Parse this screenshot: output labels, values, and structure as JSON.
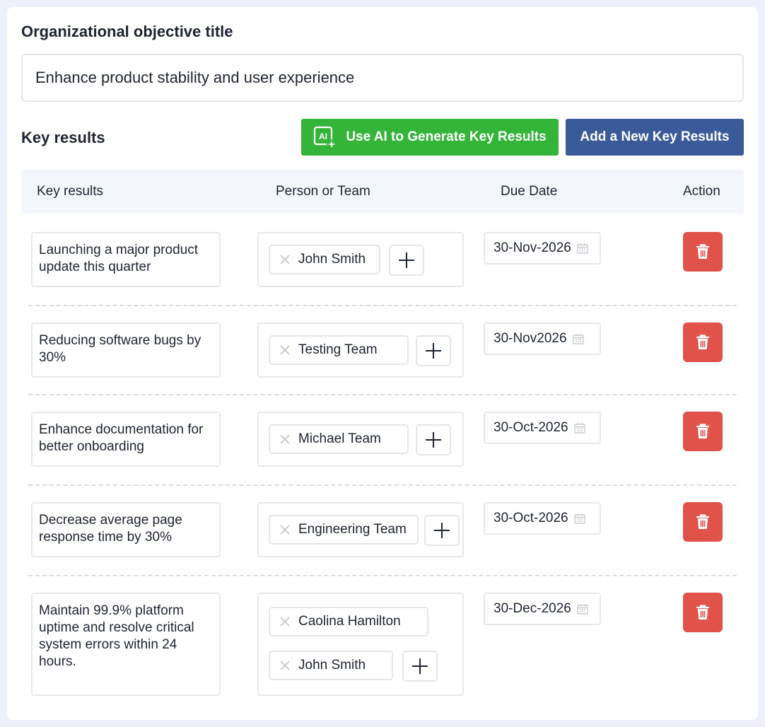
{
  "objective": {
    "label": "Organizational objective title",
    "value": "Enhance product stability and user experience"
  },
  "key_results_section": {
    "title": "Key results",
    "ai_button_label": "Use AI to Generate Key Results",
    "ai_icon_text": "AI",
    "add_button_label": "Add a New Key Results"
  },
  "table": {
    "headers": {
      "key_results": "Key results",
      "person_or_team": "Person or Team",
      "due_date": "Due Date",
      "action": "Action"
    },
    "rows": [
      {
        "key_result": "Launching a major product update this quarter",
        "assignees": [
          "John Smith"
        ],
        "due_date": "30-Nov-2026"
      },
      {
        "key_result": "Reducing software bugs by 30%",
        "assignees": [
          "Testing Team"
        ],
        "due_date": "30-Nov2026"
      },
      {
        "key_result": "Enhance documentation for better onboarding",
        "assignees": [
          "Michael Team"
        ],
        "due_date": "30-Oct-2026"
      },
      {
        "key_result": "Decrease average page response time by 30%",
        "assignees": [
          "Engineering Team"
        ],
        "due_date": "30-Oct-2026"
      },
      {
        "key_result": "Maintain 99.9% platform uptime and resolve critical system errors within 24 hours.",
        "assignees": [
          "Caolina Hamilton",
          "John Smith"
        ],
        "due_date": "30-Dec-2026"
      }
    ]
  },
  "icons": {
    "remove_assignee": "close-icon",
    "add_assignee": "plus-icon",
    "date_picker": "calendar-icon",
    "delete_row": "trash-icon",
    "ai_generate": "ai-sparkle-icon"
  },
  "colors": {
    "ai_button": "#34b53a",
    "add_button": "#3b5a9a",
    "delete_button": "#e0524a",
    "page_background": "#eef1fb"
  }
}
